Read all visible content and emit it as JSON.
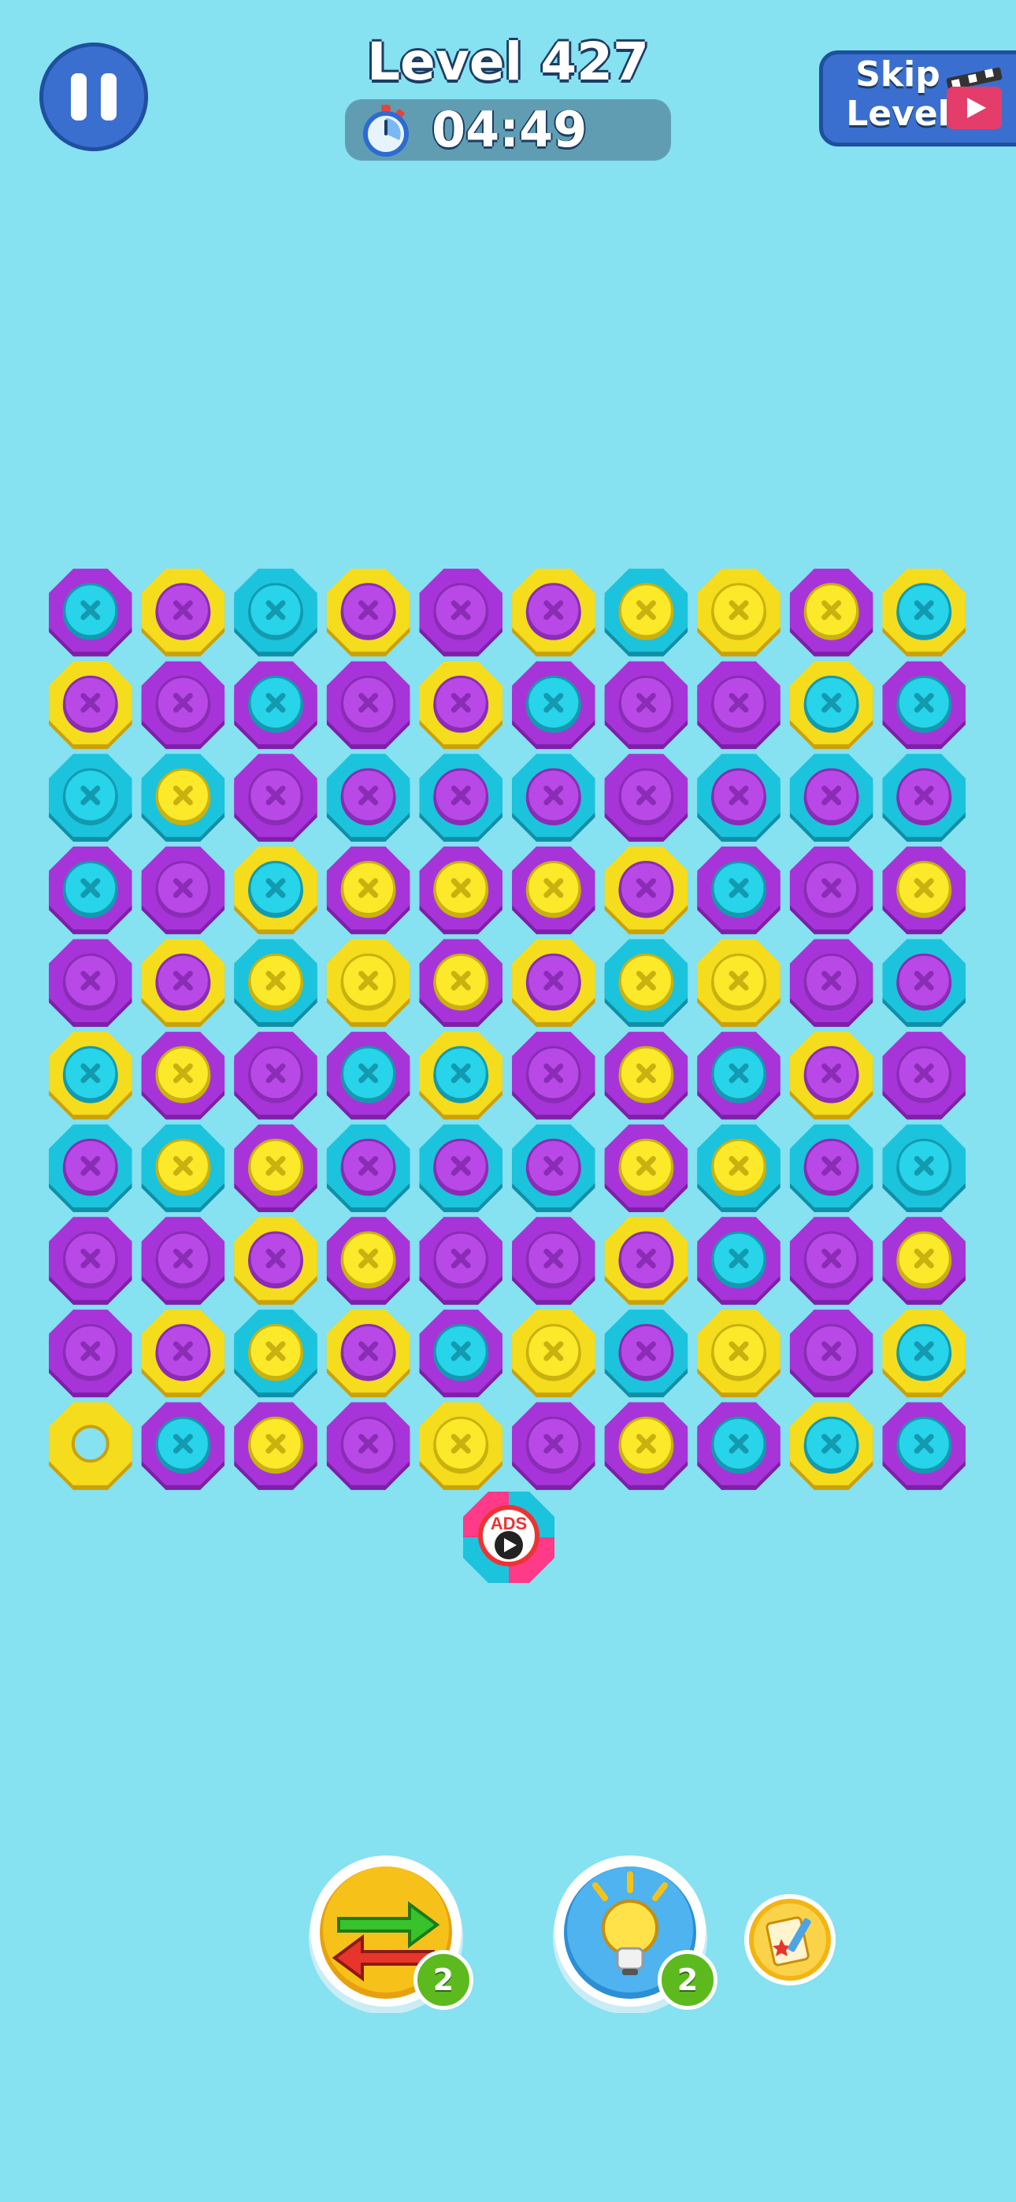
{
  "header": {
    "level_label": "Level 427",
    "timer": "04:49",
    "skip_label_line1": "Skip",
    "skip_label_line2": "Level"
  },
  "colors": {
    "background": "#86e1f1",
    "purple": "#a734d8",
    "cyan": "#1cc3dc",
    "yellow": "#f5dc1c"
  },
  "board": {
    "rows": 10,
    "cols": 10,
    "cells": [
      [
        "P:C",
        "Y:P",
        "C:C",
        "Y:P",
        "P:P",
        "Y:P",
        "C:Y",
        "Y:Y",
        "P:Y",
        "Y:C"
      ],
      [
        "Y:P",
        "P:P",
        "P:C",
        "P:P",
        "Y:P",
        "P:C",
        "P:P",
        "P:P",
        "Y:C",
        "P:C"
      ],
      [
        "C:C",
        "C:Y",
        "P:P",
        "C:P",
        "C:P",
        "C:P",
        "P:P",
        "C:P",
        "C:P",
        "C:P"
      ],
      [
        "P:C",
        "P:P",
        "Y:C",
        "P:Y",
        "P:Y",
        "P:Y",
        "Y:P",
        "P:C",
        "P:P",
        "P:Y"
      ],
      [
        "P:P",
        "Y:P",
        "C:Y",
        "Y:Y",
        "P:Y",
        "Y:P",
        "C:Y",
        "Y:Y",
        "P:P",
        "C:P"
      ],
      [
        "Y:C",
        "P:Y",
        "P:P",
        "P:C",
        "Y:C",
        "P:P",
        "P:Y",
        "P:C",
        "Y:P",
        "P:P"
      ],
      [
        "C:P",
        "C:Y",
        "P:Y",
        "C:P",
        "C:P",
        "C:P",
        "P:Y",
        "C:Y",
        "C:P",
        "C:C"
      ],
      [
        "P:P",
        "P:P",
        "Y:P",
        "P:Y",
        "P:P",
        "P:P",
        "Y:P",
        "P:C",
        "P:P",
        "P:Y"
      ],
      [
        "P:P",
        "Y:P",
        "C:Y",
        "Y:P",
        "P:C",
        "Y:Y",
        "C:P",
        "Y:Y",
        "P:P",
        "Y:C"
      ],
      [
        "Y:hole",
        "P:C",
        "P:Y",
        "P:P",
        "Y:Y",
        "P:P",
        "P:Y",
        "P:C",
        "Y:C",
        "P:C"
      ]
    ]
  },
  "ads_bolt": {
    "label": "ADS"
  },
  "tools": {
    "swap": {
      "icon": "swap-arrows-icon",
      "count": "2"
    },
    "hint": {
      "icon": "lightbulb-icon",
      "count": "2"
    },
    "tasks": {
      "icon": "task-card-icon"
    }
  }
}
